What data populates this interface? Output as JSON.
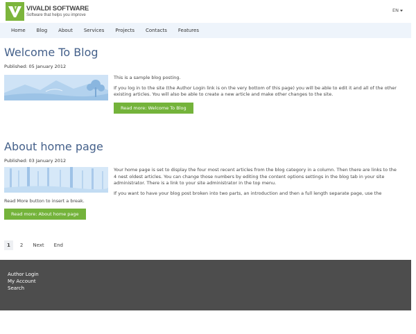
{
  "header": {
    "logo_name": "VIVALDI SOFTWARE",
    "logo_tagline": "Software that helps you improve",
    "lang": "EN"
  },
  "nav": {
    "items": [
      "Home",
      "Blog",
      "About",
      "Services",
      "Projects",
      "Contacts",
      "Features"
    ]
  },
  "articles": [
    {
      "title": "Welcome To Blog",
      "published": "Published: 05 January 2012",
      "paragraphs": [
        "This is a sample blog posting.",
        "If you log in to the site (the Author Login link is on the very bottom of this page) you will be able to edit it and all of the other existing articles. You will also be able to create a new article and make other changes to the site."
      ],
      "button": "Read more: Welcome To Blog"
    },
    {
      "title": "About home page",
      "published": "Published: 03 January 2012",
      "paragraphs": [
        "Your home page is set to display the four most recent articles from the blog category in a column. Then there are links to the 4 nest oldest articles. You can change those numbers by editing the content options settings in the blog tab in your site administrator. There is a link to your site administrator in the top menu.",
        "If you want to have your blog post broken into two parts, an introduction and then a full length separate page, use the"
      ],
      "break_note": "Read More button to insert a break.",
      "button": "Read more: About home page"
    }
  ],
  "pagination": {
    "items": [
      "1",
      "2",
      "Next",
      "End"
    ],
    "active": "1"
  },
  "footer": {
    "links": [
      "Author Login",
      "My Account",
      "Search"
    ]
  },
  "colors": {
    "accent_green": "#74b33b",
    "title_blue": "#44608a",
    "nav_bg": "#eef4fb",
    "footer_bg": "#4d4d4d"
  }
}
